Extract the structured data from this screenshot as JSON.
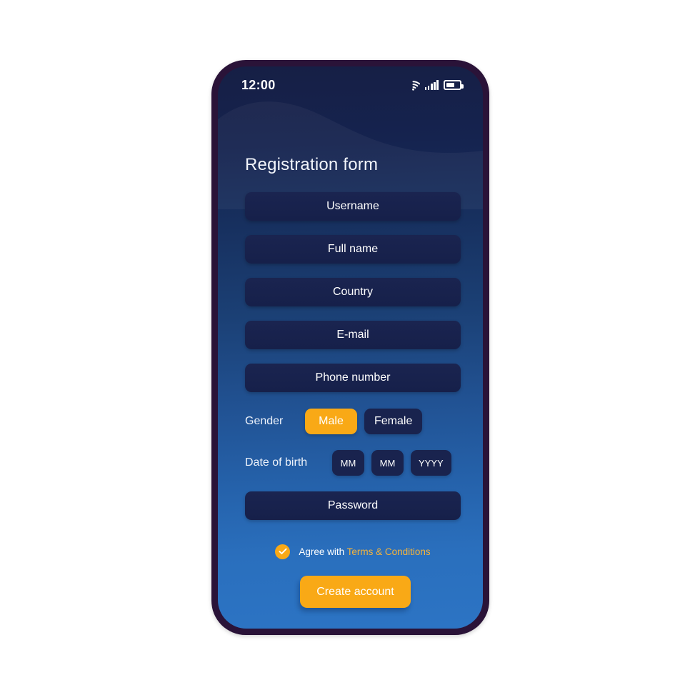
{
  "device": {
    "frame_color": "#2a1338",
    "screen_gradient_top": "#161f45",
    "screen_gradient_bottom": "#2c74c4"
  },
  "status_bar": {
    "time": "12:00",
    "icons": [
      "wifi-icon",
      "cellular-signal-icon",
      "battery-icon"
    ],
    "battery_level_percent": 62
  },
  "screen": {
    "title": "Registration form",
    "accent_color": "#f9a916",
    "field_color": "#19234e"
  },
  "fields": [
    {
      "name": "username",
      "placeholder": "Username",
      "value": ""
    },
    {
      "name": "fullname",
      "placeholder": "Full name",
      "value": ""
    },
    {
      "name": "country",
      "placeholder": "Country",
      "value": ""
    },
    {
      "name": "email",
      "placeholder": "E-mail",
      "value": ""
    },
    {
      "name": "phone",
      "placeholder": "Phone number",
      "value": ""
    }
  ],
  "gender": {
    "label": "Gender",
    "options": [
      {
        "label": "Male",
        "selected": true
      },
      {
        "label": "Female",
        "selected": false
      }
    ]
  },
  "date_of_birth": {
    "label": "Date of birth",
    "boxes": [
      {
        "placeholder": "MM"
      },
      {
        "placeholder": "MM"
      },
      {
        "placeholder": "YYYY"
      }
    ]
  },
  "password": {
    "placeholder": "Password",
    "value": ""
  },
  "terms": {
    "checked": true,
    "prefix": "Agree with ",
    "link_label": "Terms & Conditions",
    "link_color": "#f5b43c"
  },
  "primary_action": {
    "label": "Create account"
  }
}
